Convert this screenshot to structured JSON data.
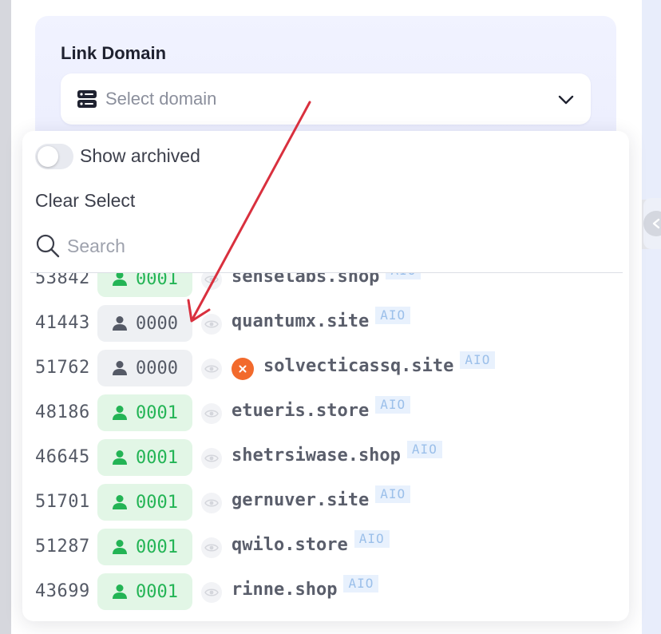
{
  "field": {
    "label": "Link Domain",
    "placeholder": "Select domain",
    "icon": "server-icon",
    "chevron_icon": "chevron-down-icon"
  },
  "dropdown": {
    "show_archived_label": "Show archived",
    "show_archived_on": false,
    "clear_select_label": "Clear Select",
    "search_placeholder": "Search"
  },
  "colors": {
    "active_badge_bg": "#e2f6e6",
    "active_badge_fg": "#23b455",
    "inactive_badge_bg": "#eef0f3",
    "tag_bg": "#e8f1fd",
    "tag_fg": "#9cc0ea",
    "status_error": "#f26a2c",
    "annotation_arrow": "#d9303e"
  },
  "domains": [
    {
      "id": "53842",
      "count": "0001",
      "active": true,
      "name": "senselabs.shop",
      "tag": "AIO",
      "error": false
    },
    {
      "id": "41443",
      "count": "0000",
      "active": false,
      "name": "quantumx.site",
      "tag": "AIO",
      "error": false
    },
    {
      "id": "51762",
      "count": "0000",
      "active": false,
      "name": "solvecticassq.site",
      "tag": "AIO",
      "error": true
    },
    {
      "id": "48186",
      "count": "0001",
      "active": true,
      "name": "etueris.store",
      "tag": "AIO",
      "error": false
    },
    {
      "id": "46645",
      "count": "0001",
      "active": true,
      "name": "shetrsiwase.shop",
      "tag": "AIO",
      "error": false
    },
    {
      "id": "51701",
      "count": "0001",
      "active": true,
      "name": "gernuver.site",
      "tag": "AIO",
      "error": false
    },
    {
      "id": "51287",
      "count": "0001",
      "active": true,
      "name": "qwilo.store",
      "tag": "AIO",
      "error": false
    },
    {
      "id": "43699",
      "count": "0001",
      "active": true,
      "name": "rinne.shop",
      "tag": "AIO",
      "error": false
    }
  ]
}
